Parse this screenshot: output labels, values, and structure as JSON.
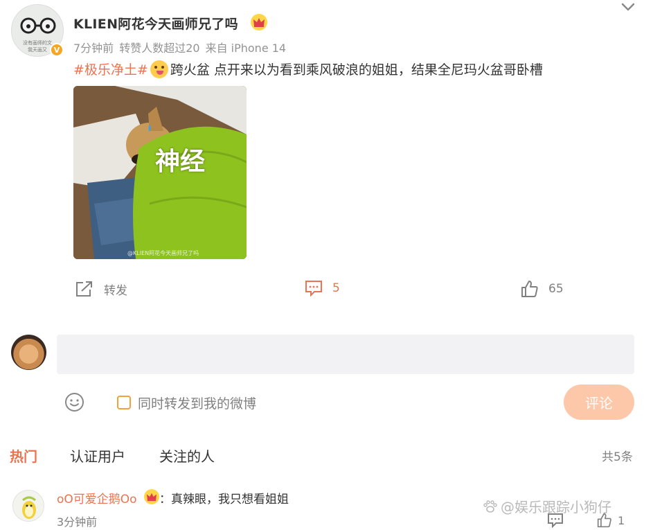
{
  "post": {
    "username": "KLIEN阿花今天画师兄了吗",
    "avatar_text": [
      "没有画师的文",
      "我天画又"
    ],
    "meta": {
      "time": "7分钟前",
      "reposts_note": "转赞人数超过20",
      "source": "来自 iPhone 14"
    },
    "text": {
      "topic": "#极乐净土#",
      "body": "跨火盆 点开来以为看到乘风破浪的姐姐，结果全尼玛火盆哥卧槽"
    },
    "image": {
      "caption": "神经",
      "watermark": "@KLIEN阿花今天画师兄了吗"
    },
    "actions": {
      "repost_label": "转发",
      "comment_count": "5",
      "like_count": "65"
    }
  },
  "compose": {
    "placeholder": "",
    "also_repost_label": "同时转发到我的微博",
    "submit_label": "评论"
  },
  "tabs": [
    {
      "label": "热门",
      "active": true
    },
    {
      "label": "认证用户",
      "active": false
    },
    {
      "label": "关注的人",
      "active": false
    }
  ],
  "total_label": "共5条",
  "comments": [
    {
      "user": "oO可爱企鹅Oo",
      "text": "：真辣眼，我只想看姐姐",
      "time": "3分钟前",
      "likes": "1"
    }
  ],
  "watermark": "@娱乐跟踪小狗仔",
  "colors": {
    "accent": "#eb7350",
    "muted": "#808080",
    "submit_bg": "#fdc8a9",
    "verified_badge": "#f6a623"
  },
  "icons": [
    "chevron-down-icon",
    "verified-icon",
    "crown-icon",
    "repost-icon",
    "comment-icon",
    "like-icon",
    "smile-icon",
    "checkbox-icon",
    "reply-icon",
    "paw-icon"
  ]
}
